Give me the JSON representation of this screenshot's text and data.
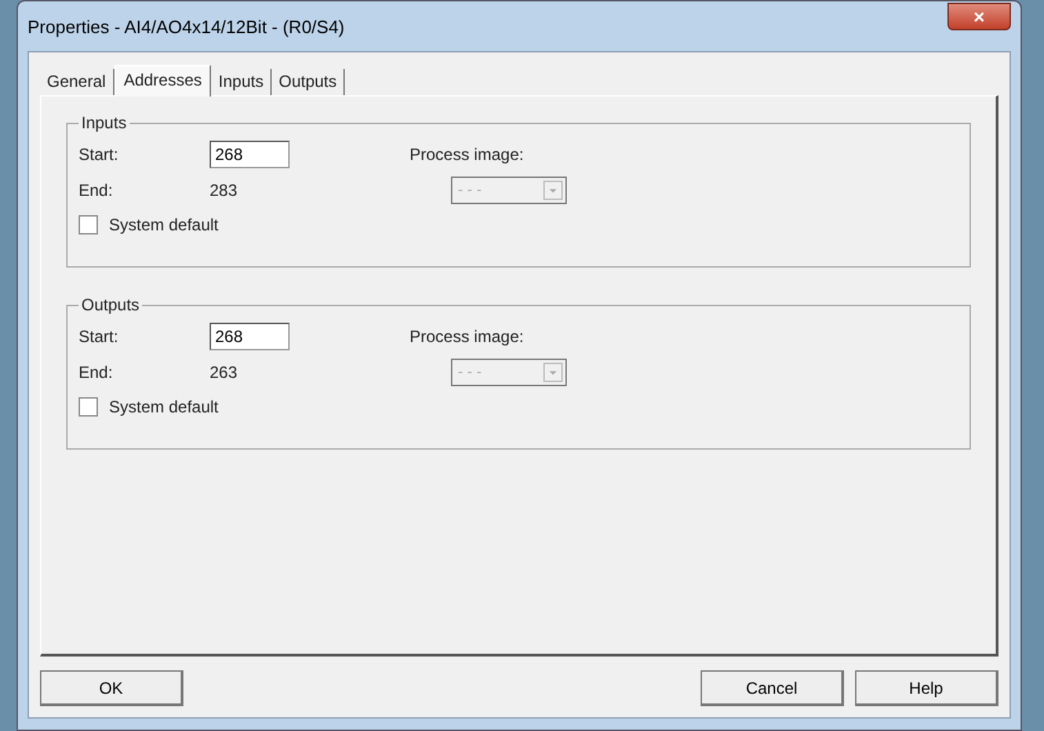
{
  "window": {
    "title": "Properties - AI4/AO4x14/12Bit - (R0/S4)",
    "close": "×"
  },
  "tabs": [
    {
      "label": "General",
      "selected": false
    },
    {
      "label": "Addresses",
      "selected": true
    },
    {
      "label": "Inputs",
      "selected": false
    },
    {
      "label": "Outputs",
      "selected": false
    }
  ],
  "groups": [
    {
      "title": "Inputs",
      "start_label": "Start:",
      "start_value": "268",
      "end_label": "End:",
      "end_value": "283",
      "process_image_label": "Process image:",
      "process_image_value": "- - -",
      "process_image_disabled": true,
      "system_default": {
        "label": "System default",
        "checked": false
      }
    },
    {
      "title": "Outputs",
      "start_label": "Start:",
      "start_value": "268",
      "end_label": "End:",
      "end_value": "263",
      "process_image_label": "Process image:",
      "process_image_value": "- - -",
      "process_image_disabled": true,
      "system_default": {
        "label": "System default",
        "checked": false
      }
    }
  ],
  "buttons": {
    "left": [
      "OK"
    ],
    "right": [
      "Cancel",
      "Help"
    ]
  }
}
